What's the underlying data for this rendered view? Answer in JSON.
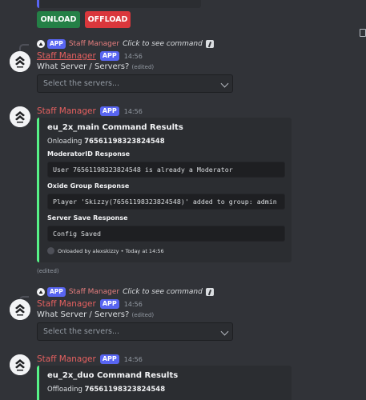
{
  "top_buttons": {
    "onload": "ONLOAD",
    "offload": "OFFLOAD"
  },
  "messages": [
    {
      "reply": {
        "app": "APP",
        "name": "Staff Manager",
        "cmd": "Click to see command"
      },
      "header": {
        "name": "Staff Manager",
        "app": "APP",
        "time": "14:56"
      },
      "text": "What Server / Servers?",
      "edited": "(edited)",
      "select_placeholder": "Select the servers..."
    },
    {
      "header": {
        "name": "Staff Manager",
        "app": "APP",
        "time": "14:56"
      },
      "embed": {
        "title": "eu_2x_main Command Results",
        "status_prefix": "Onloading",
        "status_id": "76561198323824548",
        "fields": [
          {
            "name": "ModeratorID Response",
            "value": "User 76561198323824548 is already a Moderator"
          },
          {
            "name": "Oxide Group Response",
            "value": "Player 'Skizzy(76561198323824548)' added to group: admin"
          },
          {
            "name": "Server Save Response",
            "value": "Config Saved"
          }
        ],
        "footer": "Onloaded by alexskizzy • Today at 14:56"
      },
      "edited": "(edited)"
    },
    {
      "reply": {
        "app": "APP",
        "name": "Staff Manager",
        "cmd": "Click to see command"
      },
      "header": {
        "name": "Staff Manager",
        "app": "APP",
        "time": "14:56"
      },
      "text": "What Server / Servers?",
      "edited": "(edited)",
      "select_placeholder": "Select the servers..."
    },
    {
      "header": {
        "name": "Staff Manager",
        "app": "APP",
        "time": "14:56"
      },
      "embed": {
        "title": "eu_2x_duo Command Results",
        "status_prefix": "Offloading",
        "status_id": "76561198323824548"
      }
    }
  ],
  "colors": {
    "accent_green": "#57f287",
    "username": "#e4605f",
    "app_tag": "#5865f2"
  },
  "icons": [
    "bot-avatar-icon",
    "slash-command-icon",
    "chevron-down-icon",
    "reply-avatar-icon"
  ]
}
